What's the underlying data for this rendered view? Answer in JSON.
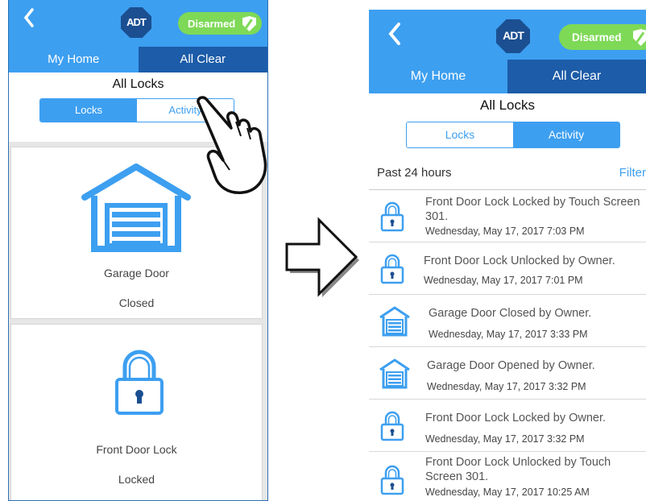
{
  "left_screen": {
    "header": {
      "back_icon": "chevron-left-icon",
      "logo": "ADT",
      "status": "Disarmed"
    },
    "tabs": [
      {
        "label": "My Home",
        "active": false
      },
      {
        "label": "All Clear",
        "active": true
      }
    ],
    "title": "All Locks",
    "segments": [
      {
        "label": "Locks",
        "selected": true
      },
      {
        "label": "Activity",
        "selected": false
      }
    ],
    "devices": [
      {
        "icon": "garage-door-icon",
        "name": "Garage Door",
        "status": "Closed"
      },
      {
        "icon": "padlock-icon",
        "name": "Front Door Lock",
        "status": "Locked"
      }
    ]
  },
  "transition_arrow_icon": "right-arrow-icon",
  "right_screen": {
    "header": {
      "back_icon": "chevron-left-icon",
      "logo": "ADT",
      "status": "Disarmed"
    },
    "tabs": [
      {
        "label": "My Home",
        "active": false
      },
      {
        "label": "All Clear",
        "active": true
      }
    ],
    "title": "All Locks",
    "segments": [
      {
        "label": "Locks",
        "selected": false
      },
      {
        "label": "Activity",
        "selected": true
      }
    ],
    "period": "Past 24 hours",
    "filter_label": "Filter",
    "activity": [
      {
        "icon": "padlock-icon",
        "event": "Front Door Lock Locked by Touch Screen 301.",
        "time": "Wednesday, May 17, 2017   7:03 PM"
      },
      {
        "icon": "padlock-icon",
        "event": "Front Door Lock Unlocked by Owner.",
        "time": "Wednesday, May 17, 2017   7:01 PM"
      },
      {
        "icon": "garage-door-icon",
        "event": "Garage Door Closed by Owner.",
        "time": "Wednesday, May 17, 2017   3:33 PM"
      },
      {
        "icon": "garage-door-icon",
        "event": "Garage Door Opened by Owner.",
        "time": "Wednesday, May 17, 2017   3:32 PM"
      },
      {
        "icon": "padlock-icon",
        "event": "Front Door Lock Locked by Owner.",
        "time": "Wednesday, May 17, 2017   3:32 PM"
      },
      {
        "icon": "padlock-icon",
        "event": "Front Door Lock Unlocked by Touch Screen 301.",
        "time": "Wednesday, May 17, 2017   10:25 AM"
      }
    ]
  },
  "colors": {
    "accent": "#3d9ff0",
    "tab_active": "#1c5ca8",
    "logo": "#1b4f91",
    "disarmed": "#7ed957"
  }
}
